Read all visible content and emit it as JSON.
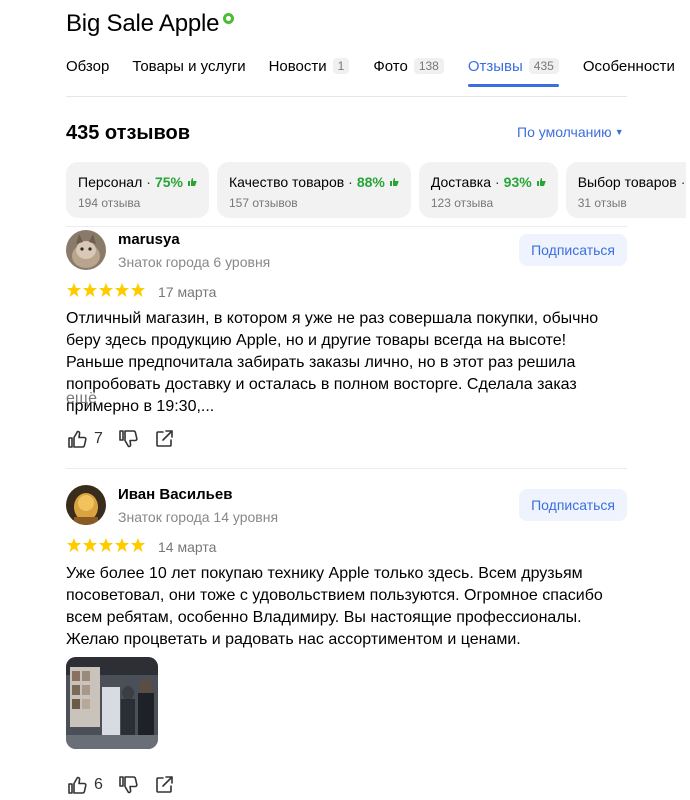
{
  "header": {
    "title": "Big Sale Apple"
  },
  "tabs": [
    {
      "label": "Обзор",
      "badge": ""
    },
    {
      "label": "Товары и услуги",
      "badge": ""
    },
    {
      "label": "Новости",
      "badge": "1"
    },
    {
      "label": "Фото",
      "badge": "138"
    },
    {
      "label": "Отзывы",
      "badge": "435",
      "active": true
    },
    {
      "label": "Особенности",
      "badge": ""
    }
  ],
  "reviews_header": {
    "count_label": "435 отзывов",
    "sort_label": "По умолчанию"
  },
  "aspects": [
    {
      "name": "Персонал",
      "percent": "75%",
      "count": "194 отзыва"
    },
    {
      "name": "Качество товаров",
      "percent": "88%",
      "count": "157 отзывов"
    },
    {
      "name": "Доставка",
      "percent": "93%",
      "count": "123 отзыва"
    },
    {
      "name": "Выбор товаров",
      "percent": "",
      "count": "31 отзыв"
    }
  ],
  "reviews": [
    {
      "author": "marusya",
      "level": "Знаток города 6 уровня",
      "subscribe_label": "Подписаться",
      "rating": 5,
      "date": "17 марта",
      "text": "Отличный магазин, в котором я уже не раз совершала покупки, обычно беру здесь продукцию Apple, но и другие товары всегда на высоте! Раньше предпочитала забирать заказы лично, но в этот раз решила попробовать доставку и осталась в полном восторге. Сделала заказ примерно в 19:30,...",
      "more_label": "ещё",
      "likes": "7"
    },
    {
      "author": "Иван Васильев",
      "level": "Знаток города 14 уровня",
      "subscribe_label": "Подписаться",
      "rating": 5,
      "date": "14 марта",
      "text": "Уже более 10 лет покупаю технику Apple только здесь. Всем друзьям посоветовал, они тоже с удовольствием пользуются. Огромное спасибо всем ребятам, особенно Владимиру. Вы настоящие профессионалы. Желаю процветать и радовать нас ассортиментом и ценами.",
      "likes": "6"
    }
  ],
  "colors": {
    "accent": "#3c6ee0",
    "positive": "#26a636",
    "star": "#fc0"
  },
  "icons": [
    "verified-icon",
    "thumb-up-icon",
    "thumb-down-icon",
    "share-icon",
    "star-icon",
    "caret-down-icon"
  ]
}
